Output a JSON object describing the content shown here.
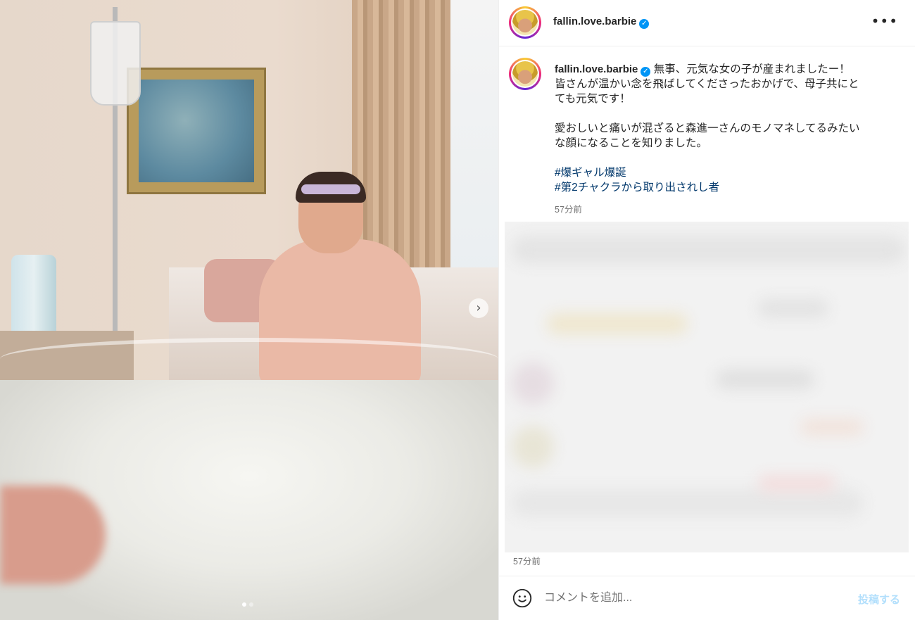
{
  "post": {
    "username": "fallin.love.barbie",
    "verified_glyph": "✓",
    "more_glyph": "•••",
    "next_glyph": "›",
    "image_count": 2,
    "active_image_index": 0
  },
  "caption": {
    "line1": "無事、元気な女の子が産まれましたー！",
    "line2": "皆さんが温かい念を飛ばしてくださったおかげで、母子共にと",
    "line3": "ても元気です！",
    "line4": "愛おしいと痛いが混ざると森進一さんのモノマネしてるみたい",
    "line5": "な顔になることを知りました。",
    "hashtags": [
      "#爆ギャル爆誕",
      "#第2チャクラから取り出されし者"
    ],
    "time": "57分前"
  },
  "comments": {
    "time": "57分前"
  },
  "comment_bar": {
    "placeholder": "コメントを追加...",
    "post_label": "投稿する"
  },
  "icons": {
    "emoji": "smiley-icon",
    "verified": "verified-badge-icon",
    "more": "more-options-icon",
    "next": "chevron-right-icon"
  },
  "colors": {
    "link": "#00376b",
    "verified": "#0095f6",
    "post_button_disabled": "#b2dffc",
    "muted_text": "#737373"
  }
}
